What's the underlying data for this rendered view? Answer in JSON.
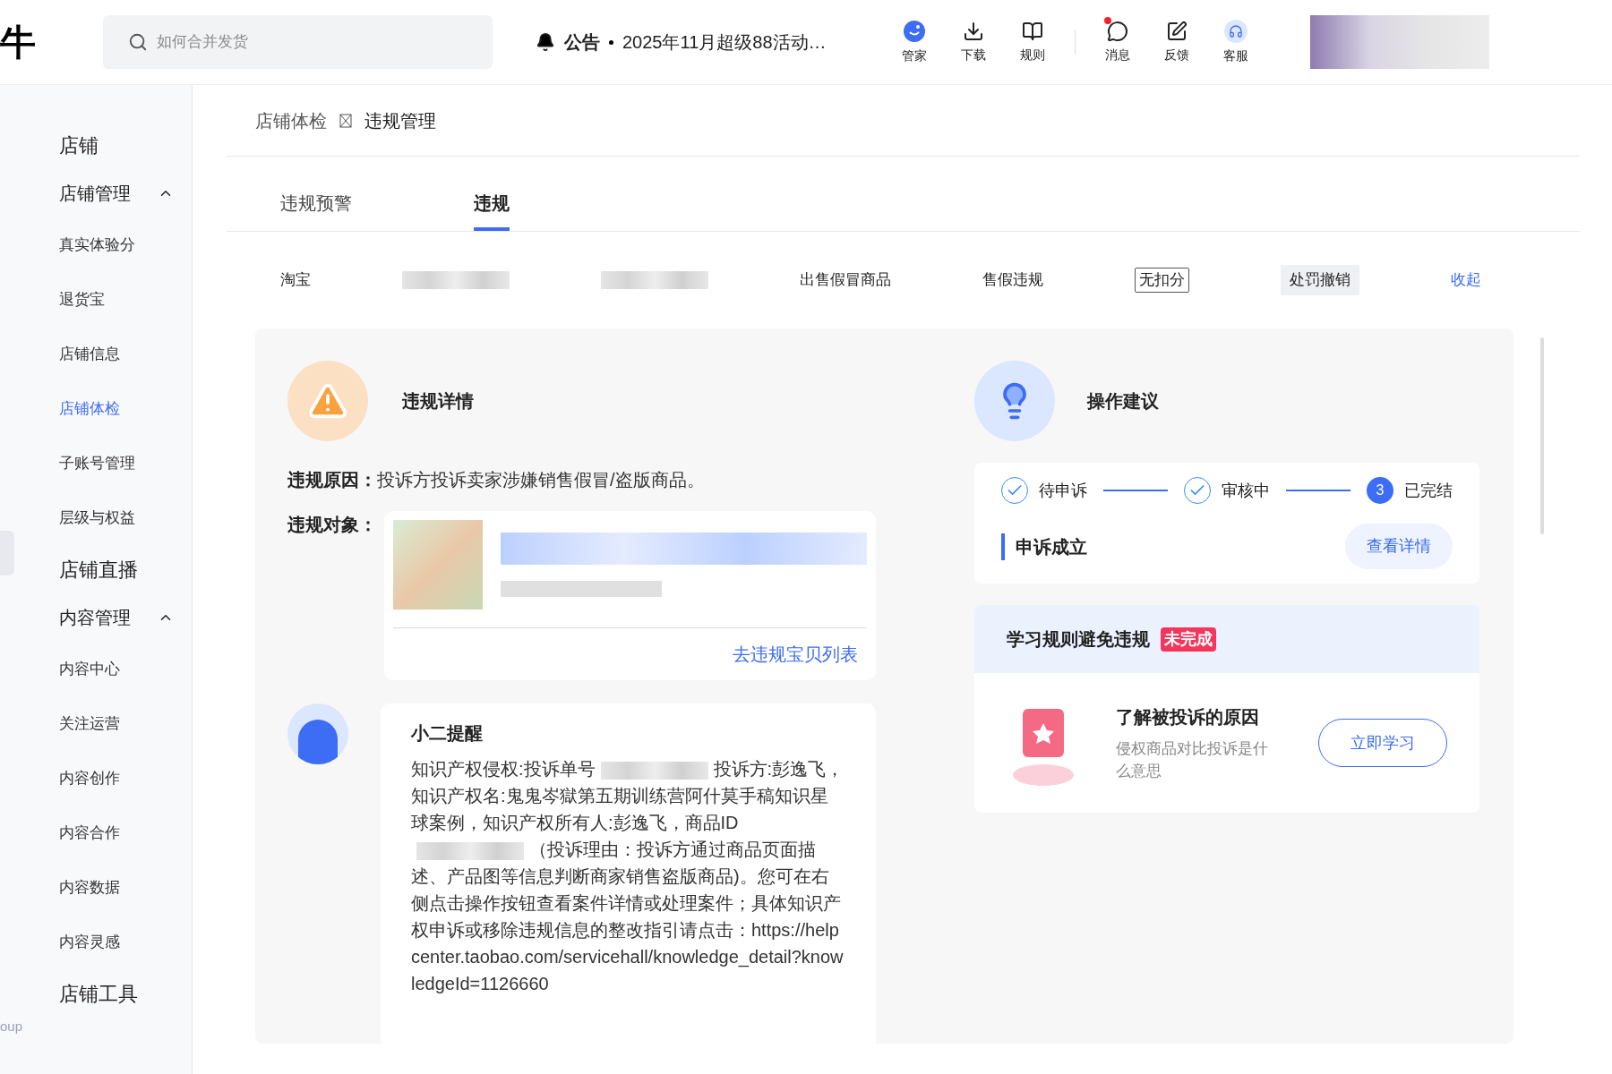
{
  "header": {
    "logo": "牛",
    "search": {
      "placeholder": "如何合并发货"
    },
    "notice": {
      "label": "公告",
      "text": "2025年11月超级88活动…"
    },
    "tools": [
      {
        "label": "管家",
        "unread": false
      },
      {
        "label": "下载",
        "unread": false
      },
      {
        "label": "规则",
        "unread": false
      },
      {
        "label": "消息",
        "unread": true
      },
      {
        "label": "反馈",
        "unread": false
      },
      {
        "label": "客服",
        "unread": false
      }
    ]
  },
  "sidebar": {
    "footer": "oup",
    "items": [
      {
        "kind": "title",
        "label": "店铺"
      },
      {
        "kind": "group",
        "label": "店铺管理",
        "expanded": true,
        "children": [
          {
            "label": "真实体验分",
            "selected": false
          },
          {
            "label": "退货宝",
            "selected": false
          },
          {
            "label": "店铺信息",
            "selected": false
          },
          {
            "label": "店铺体检",
            "selected": true
          },
          {
            "label": "子账号管理",
            "selected": false
          },
          {
            "label": "层级与权益",
            "selected": false
          }
        ]
      },
      {
        "kind": "title",
        "label": "店铺直播"
      },
      {
        "kind": "group",
        "label": "内容管理",
        "expanded": true,
        "children": [
          {
            "label": "内容中心",
            "selected": false
          },
          {
            "label": "关注运营",
            "selected": false
          },
          {
            "label": "内容创作",
            "selected": false
          },
          {
            "label": "内容合作",
            "selected": false
          },
          {
            "label": "内容数据",
            "selected": false
          },
          {
            "label": "内容灵感",
            "selected": false
          }
        ]
      },
      {
        "kind": "title",
        "label": "店铺工具"
      }
    ]
  },
  "breadcrumb": [
    "店铺体检",
    "违规管理"
  ],
  "tabs": [
    {
      "label": "违规预警",
      "selected": false
    },
    {
      "label": "违规",
      "selected": true
    }
  ],
  "record": [
    {
      "kind": "text",
      "text": "淘宝"
    },
    {
      "kind": "redacted"
    },
    {
      "kind": "redacted"
    },
    {
      "kind": "text",
      "text": "出售假冒商品"
    },
    {
      "kind": "text",
      "text": "售假违规"
    },
    {
      "kind": "outline_tag",
      "text": "无扣分"
    },
    {
      "kind": "tag",
      "text": "处罚撤销"
    },
    {
      "kind": "link",
      "text": "收起"
    }
  ],
  "detail": {
    "title": "违规详情",
    "reason_label": "违规原因：",
    "reason": "投诉方投诉卖家涉嫌销售假冒/盗版商品。",
    "object_label": "违规对象：",
    "object_link": "去违规宝贝列表",
    "reminder": {
      "title": "小二提醒",
      "body": [
        {
          "kind": "text",
          "text": "知识产权侵权:投诉单号"
        },
        {
          "kind": "redacted"
        },
        {
          "kind": "text",
          "text": "投诉方:彭逸飞，知识产权名:鬼鬼岑獄第五期训练营阿什莫手稿知识星球案例，知识产权所有人:彭逸飞，商品ID"
        },
        {
          "kind": "redacted"
        },
        {
          "kind": "text",
          "text": "（投诉理由：投诉方通过商品页面描述、产品图等信息判断商家销售盗版商品)。您可在右侧点击操作按钮查看案件详情或处理案件；具体知识产权申诉或移除违规信息的整改指引请点击：https://helpcenter.taobao.com/servicehall/knowledge_detail?knowledgeId=1126660"
        }
      ]
    }
  },
  "advice": {
    "title": "操作建议",
    "steps": [
      {
        "label": "待申诉",
        "done": true
      },
      {
        "label": "审核中",
        "done": true
      },
      {
        "label": "已完结",
        "done": false,
        "number": "3"
      }
    ],
    "result": "申诉成立",
    "result_button": "查看详情",
    "learn": {
      "title": "学习规则避免违规",
      "badge": "未完成",
      "item_title": "了解被投诉的原因",
      "item_subtitle": "侵权商品对比投诉是什么意思",
      "button": "立即学习"
    }
  }
}
